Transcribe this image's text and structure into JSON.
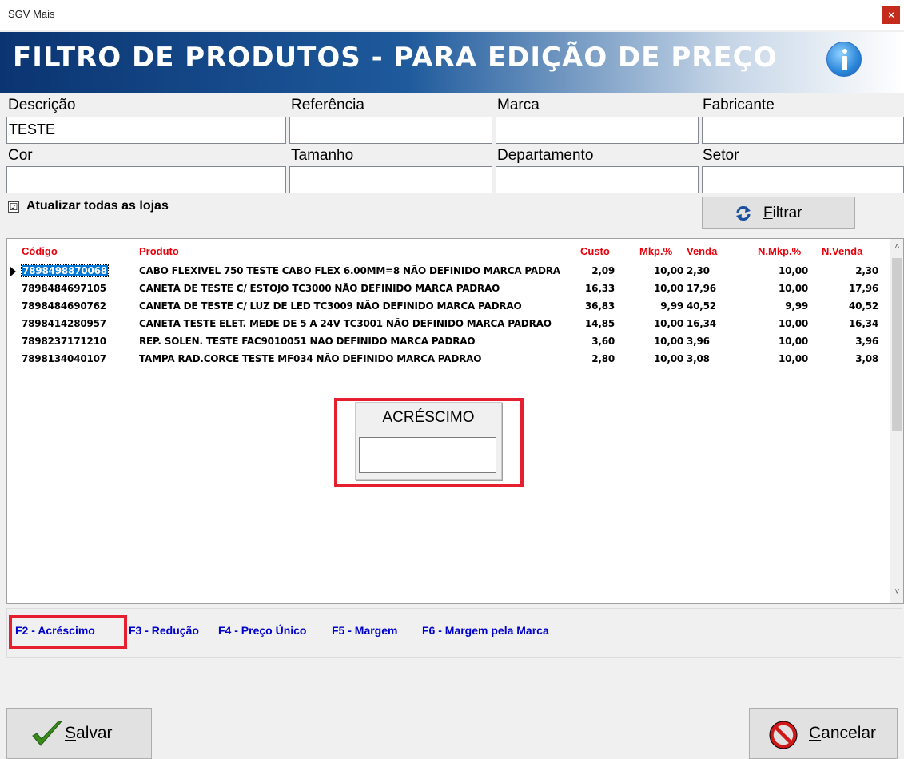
{
  "window": {
    "title": "SGV Mais",
    "close_label": "×"
  },
  "banner": {
    "heading": "FILTRO DE PRODUTOS - PARA EDIÇÃO DE PREÇO",
    "icon": "info-icon"
  },
  "filters": {
    "descricao": {
      "label": "Descrição",
      "value": "TESTE"
    },
    "referencia": {
      "label": "Referência",
      "value": ""
    },
    "marca": {
      "label": "Marca",
      "value": ""
    },
    "fabricante": {
      "label": "Fabricante",
      "value": ""
    },
    "cor": {
      "label": "Cor",
      "value": ""
    },
    "tamanho": {
      "label": "Tamanho",
      "value": ""
    },
    "departamento": {
      "label": "Departamento",
      "value": ""
    },
    "setor": {
      "label": "Setor",
      "value": ""
    }
  },
  "update_all": {
    "checked_mark": "☑",
    "label": "Atualizar todas as lojas"
  },
  "filter_button": {
    "accel": "F",
    "rest": "iltrar",
    "icon": "refresh-icon"
  },
  "grid": {
    "headers": {
      "codigo": "Código",
      "produto": "Produto",
      "custo": "Custo",
      "mkp": "Mkp.%",
      "venda": "Venda",
      "nmkp": "N.Mkp.%",
      "nvenda": "N.Venda"
    },
    "rows": [
      {
        "codigo": "7898498870068",
        "produto": "CABO FLEXIVEL 750   TESTE CABO FLEX 6.00MM=8 NÃO DEFINIDO MARCA PADRAO",
        "custo": "2,09",
        "mkp": "10,00",
        "venda": "2,30",
        "nmkp": "10,00",
        "nvenda": "2,30"
      },
      {
        "codigo": "7898484697105",
        "produto": "CANETA DE TESTE C/ ESTOJO TC3000 NÃO DEFINIDO MARCA PADRAO",
        "custo": "16,33",
        "mkp": "10,00",
        "venda": "17,96",
        "nmkp": "10,00",
        "nvenda": "17,96"
      },
      {
        "codigo": "7898484690762",
        "produto": "CANETA DE TESTE C/ LUZ DE LED TC3009 NÃO DEFINIDO MARCA PADRAO",
        "custo": "36,83",
        "mkp": "9,99",
        "venda": "40,52",
        "nmkp": "9,99",
        "nvenda": "40,52"
      },
      {
        "codigo": "7898414280957",
        "produto": "CANETA TESTE ELET. MEDE DE 5 A 24V TC3001 NÃO DEFINIDO MARCA PADRAO",
        "custo": "14,85",
        "mkp": "10,00",
        "venda": "16,34",
        "nmkp": "10,00",
        "nvenda": "16,34"
      },
      {
        "codigo": "7898237171210",
        "produto": "REP. SOLEN. TESTE FAC9010051 NÃO DEFINIDO MARCA PADRAO",
        "custo": "3,60",
        "mkp": "10,00",
        "venda": "3,96",
        "nmkp": "10,00",
        "nvenda": "3,96"
      },
      {
        "codigo": "7898134040107",
        "produto": "TAMPA RAD.CORCE TESTE MF034 NÃO DEFINIDO MARCA PADRAO",
        "custo": "2,80",
        "mkp": "10,00",
        "venda": "3,08",
        "nmkp": "10,00",
        "nvenda": "3,08"
      }
    ],
    "scroll_up": "˄",
    "scroll_down": "˅"
  },
  "popup": {
    "title": "ACRÉSCIMO",
    "value": ""
  },
  "shortcuts": [
    "F2 - Acréscimo",
    "F3 - Redução",
    "F4 - Preço Único",
    "F5 - Margem",
    "F6 - Margem pela Marca"
  ],
  "footer": {
    "save": {
      "accel": "S",
      "rest": "alvar",
      "icon": "checkmark-icon"
    },
    "cancel": {
      "accel": "C",
      "rest": "ancelar",
      "icon": "no-entry-icon"
    }
  },
  "colors": {
    "header_red": "#e8000a",
    "shortcut_blue": "#0000cc",
    "highlight_red": "#e51f30",
    "selection_blue": "#0078d7"
  }
}
